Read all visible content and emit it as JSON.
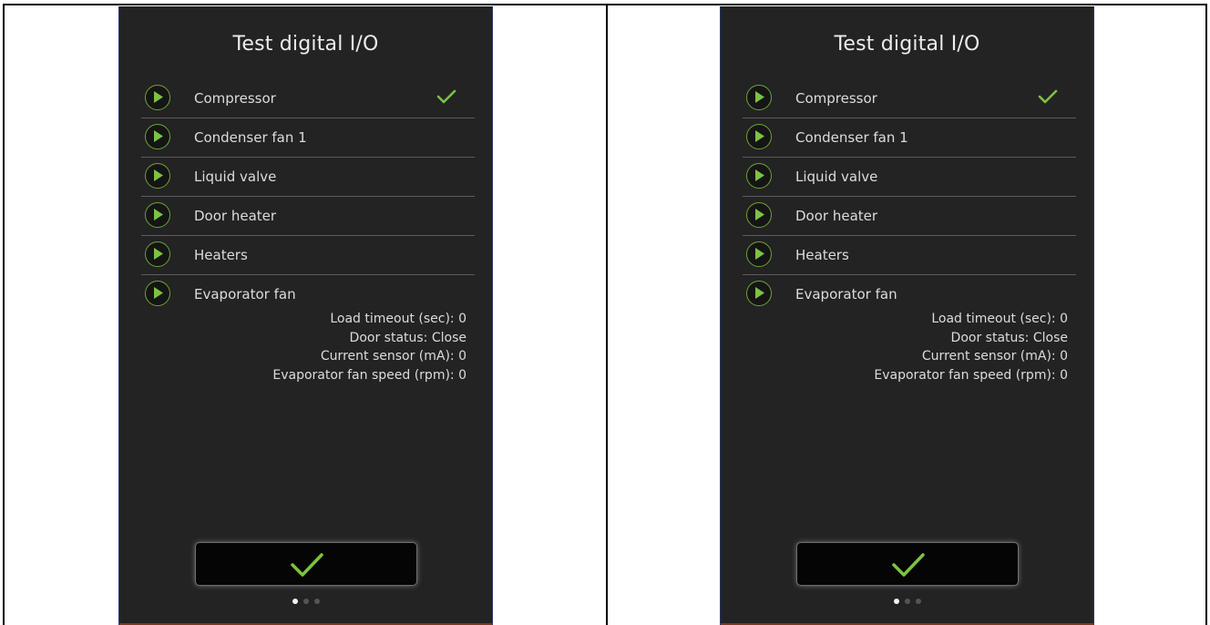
{
  "screens": [
    {
      "title": "Test digital I/O",
      "items": [
        {
          "label": "Compressor",
          "checked": true
        },
        {
          "label": "Condenser fan 1",
          "checked": false
        },
        {
          "label": "Liquid valve",
          "checked": false
        },
        {
          "label": "Door heater",
          "checked": false
        },
        {
          "label": "Heaters",
          "checked": false
        },
        {
          "label": "Evaporator fan",
          "checked": false
        }
      ],
      "info": {
        "load_timeout": "Load timeout (sec): 0",
        "door_status": "Door status: Close",
        "current_sensor": "Current sensor (mA): 0",
        "evap_fan_speed": "Evaporator fan speed (rpm): 0"
      },
      "confirm_icon": "checkmark-icon",
      "pager": {
        "pages": 3,
        "active": 1
      }
    },
    {
      "title": "Test digital I/O",
      "items": [
        {
          "label": "Compressor",
          "checked": true
        },
        {
          "label": "Condenser fan 1",
          "checked": false
        },
        {
          "label": "Liquid valve",
          "checked": false
        },
        {
          "label": "Door heater",
          "checked": false
        },
        {
          "label": "Heaters",
          "checked": false
        },
        {
          "label": "Evaporator fan",
          "checked": false
        }
      ],
      "info": {
        "load_timeout": "Load timeout (sec): 0",
        "door_status": "Door status: Close",
        "current_sensor": "Current sensor (mA): 0",
        "evap_fan_speed": "Evaporator fan speed (rpm): 0"
      },
      "confirm_icon": "checkmark-icon",
      "pager": {
        "pages": 3,
        "active": 1
      }
    }
  ],
  "colors": {
    "screen_bg": "#232323",
    "accent_green": "#6aa437",
    "text": "#dcdcdc"
  }
}
